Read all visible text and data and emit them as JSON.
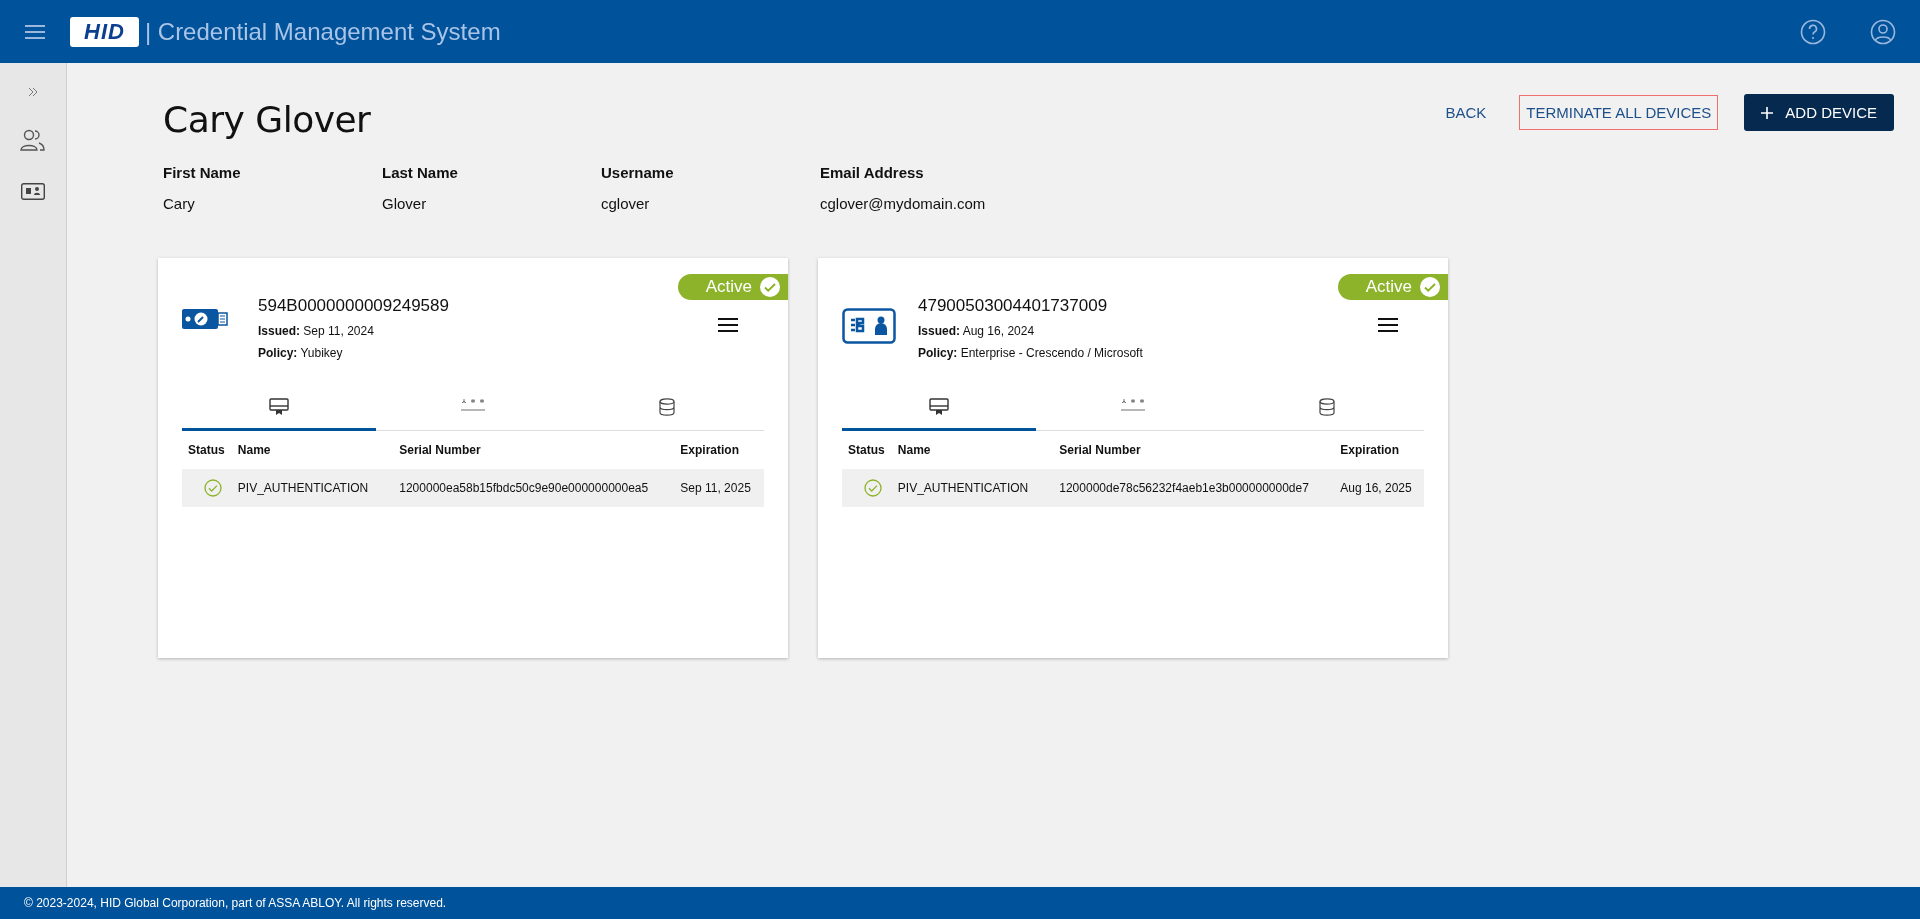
{
  "header": {
    "logo": "HID",
    "title": "| Credential Management System"
  },
  "page": {
    "title": "Cary Glover"
  },
  "actions": [
    {
      "label": "BACK",
      "kind": "text",
      "highlighted": false
    },
    {
      "label": "TERMINATE ALL DEVICES",
      "kind": "text",
      "highlighted": true
    },
    {
      "label": "ADD DEVICE",
      "kind": "primary",
      "highlighted": false
    }
  ],
  "user_fields": [
    {
      "label": "First Name",
      "value": "Cary"
    },
    {
      "label": "Last Name",
      "value": "Glover"
    },
    {
      "label": "Username",
      "value": "cglover"
    },
    {
      "label": "Email Address",
      "value": "cglover@mydomain.com"
    }
  ],
  "devices": [
    {
      "kind": "usb-key",
      "serial": "594B0000000009249589",
      "issued_label": "Issued:",
      "issued": "Sep 11, 2024",
      "policy_label": "Policy:",
      "policy": "Yubikey",
      "status": "Active",
      "active": true,
      "tabs": [
        {
          "kind": "certificate",
          "selected": true
        },
        {
          "kind": "pin",
          "selected": false
        },
        {
          "kind": "storage",
          "selected": false
        }
      ],
      "columns": [
        "Status",
        "Name",
        "Serial Number",
        "Expiration"
      ],
      "rows": [
        {
          "valid": true,
          "name": "PIV_AUTHENTICATION",
          "serial": "1200000ea58b15fbdc50c9e90e000000000ea5",
          "expiration": "Sep 11, 2025"
        }
      ]
    },
    {
      "kind": "smart-card",
      "serial": "47900503004401737009",
      "issued_label": "Issued:",
      "issued": "Aug 16, 2024",
      "policy_label": "Policy:",
      "policy": "Enterprise - Crescendo / Microsoft",
      "status": "Active",
      "active": true,
      "tabs": [
        {
          "kind": "certificate",
          "selected": true
        },
        {
          "kind": "pin",
          "selected": false
        },
        {
          "kind": "storage",
          "selected": false
        }
      ],
      "columns": [
        "Status",
        "Name",
        "Serial Number",
        "Expiration"
      ],
      "rows": [
        {
          "valid": true,
          "name": "PIV_AUTHENTICATION",
          "serial": "1200000de78c56232f4aeb1e3b000000000de7",
          "expiration": "Aug 16, 2025"
        }
      ]
    }
  ],
  "footer": {
    "text": "© 2023-2024, HID Global Corporation, part of ASSA ABLOY. All rights reserved."
  }
}
